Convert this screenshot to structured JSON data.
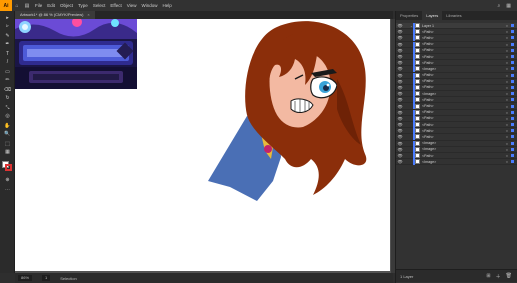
{
  "menubar": {
    "logo": "Ai",
    "icons": [
      "home-icon",
      "layout-icon"
    ],
    "items": [
      "File",
      "Edit",
      "Object",
      "Type",
      "Select",
      "Effect",
      "View",
      "Window",
      "Help"
    ],
    "right_icons": [
      "search-icon",
      "grid-icon"
    ]
  },
  "document_tab": {
    "title": "Artwork1* @ 86 % (CMYK/Preview)",
    "close": "×"
  },
  "tools": [
    "▸",
    "▹",
    "✎",
    "✒",
    "T",
    "/",
    "▭",
    "✏",
    "⌫",
    "↻",
    "⤡",
    "◎",
    "✋",
    "🔍",
    "⬚",
    "▦",
    "⊕",
    "⋯"
  ],
  "statusbar": {
    "zoom": "86%",
    "page": "1",
    "status": "Selection"
  },
  "panel": {
    "tabs": [
      "Properties",
      "Layers",
      "Libraries"
    ],
    "active_tab": "Layers",
    "layers": [
      {
        "name": "Layer 1",
        "expand": "⌄",
        "top": true
      },
      {
        "name": "<Path>"
      },
      {
        "name": "<Path>"
      },
      {
        "name": "<Path>"
      },
      {
        "name": "<Path>"
      },
      {
        "name": "<Path>"
      },
      {
        "name": "<Path>"
      },
      {
        "name": "<Image>"
      },
      {
        "name": "<Path>"
      },
      {
        "name": "<Path>"
      },
      {
        "name": "<Path>"
      },
      {
        "name": "<Image>"
      },
      {
        "name": "<Path>"
      },
      {
        "name": "<Path>"
      },
      {
        "name": "<Path>"
      },
      {
        "name": "<Path>"
      },
      {
        "name": "<Path>"
      },
      {
        "name": "<Path>"
      },
      {
        "name": "<Path>"
      },
      {
        "name": "<Image>"
      },
      {
        "name": "<Image>"
      },
      {
        "name": "<Path>"
      },
      {
        "name": "<Image>"
      }
    ],
    "footer_label": "1 Layer"
  },
  "colors": {
    "hair": "#8b2e0a",
    "skin": "#f3b9a2",
    "shirt": "#4a6fb5",
    "collar": "#e8b93a",
    "layer_accent": "#4a7cff",
    "app_accent": "#ff9a00"
  }
}
